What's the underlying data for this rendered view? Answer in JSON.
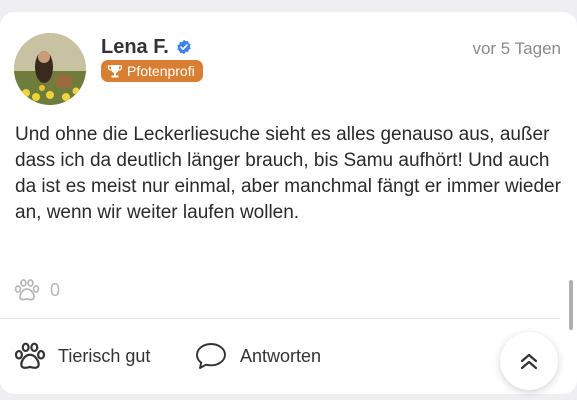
{
  "post": {
    "author": "Lena F.",
    "badge": "Pfotenprofi",
    "time": "vor 5 Tagen",
    "text": "Und ohne die Leckerliesuche sieht es alles genauso aus, außer dass ich da deutlich länger brauch, bis Samu aufhört! Und auch da ist es meist nur einmal, aber manchmal fängt er immer wieder an, wenn wir weiter laufen wollen.",
    "paw_count": "0"
  },
  "actions": {
    "like_label": "Tierisch gut",
    "reply_label": "Antworten"
  },
  "colors": {
    "badge": "#d97f33",
    "verified": "#3b82f6",
    "text": "#2a2a2a",
    "muted": "#8b8b8b"
  },
  "icons": [
    "verified-check-icon",
    "trophy-icon",
    "paw-icon",
    "speech-bubble-icon",
    "double-chevron-up-icon"
  ]
}
